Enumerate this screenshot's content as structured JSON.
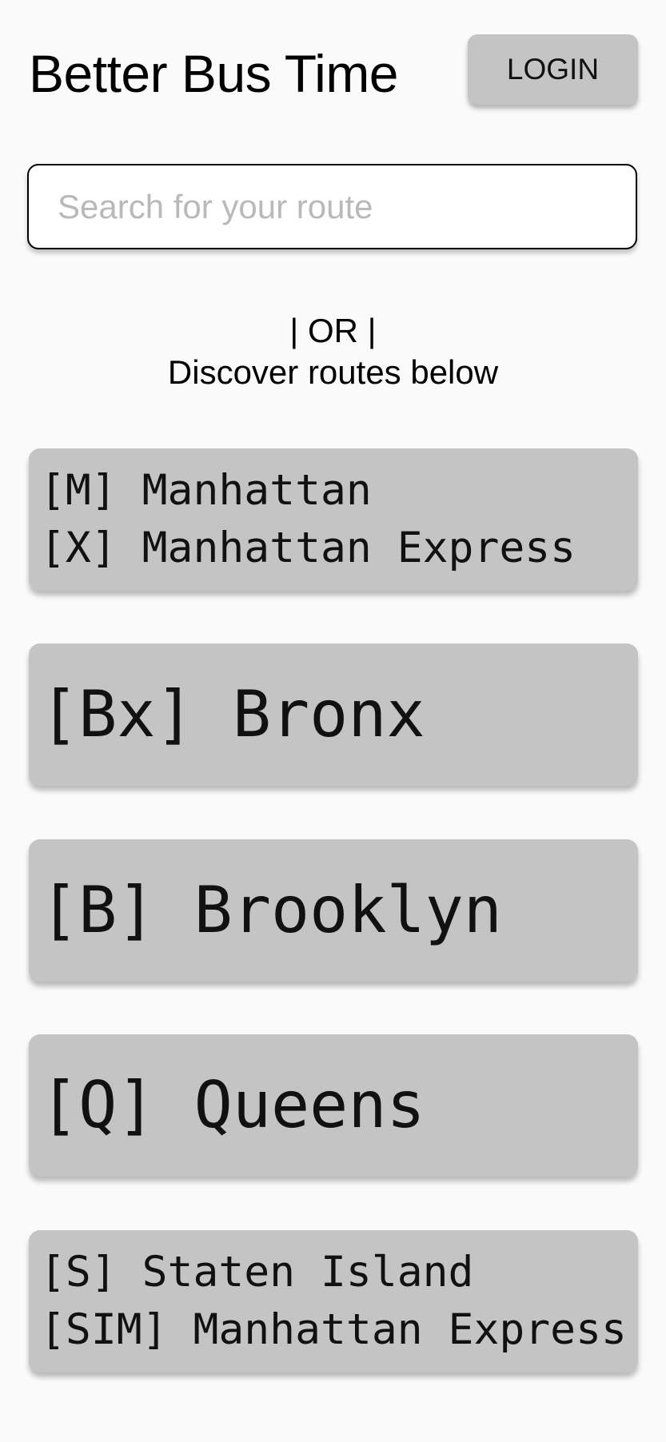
{
  "header": {
    "title": "Better Bus Time",
    "login_label": "LOGIN"
  },
  "search": {
    "placeholder": "Search for your route",
    "value": ""
  },
  "divider": {
    "line1": "| OR |",
    "line2": "Discover routes below"
  },
  "routes": [
    {
      "lines": [
        "[M] Manhattan",
        "[X] Manhattan Express"
      ]
    },
    {
      "lines": [
        "[Bx] Bronx"
      ]
    },
    {
      "lines": [
        "[B] Brooklyn"
      ]
    },
    {
      "lines": [
        "[Q] Queens"
      ]
    },
    {
      "lines": [
        "[S] Staten Island",
        "[SIM] Manhattan Express"
      ]
    }
  ]
}
